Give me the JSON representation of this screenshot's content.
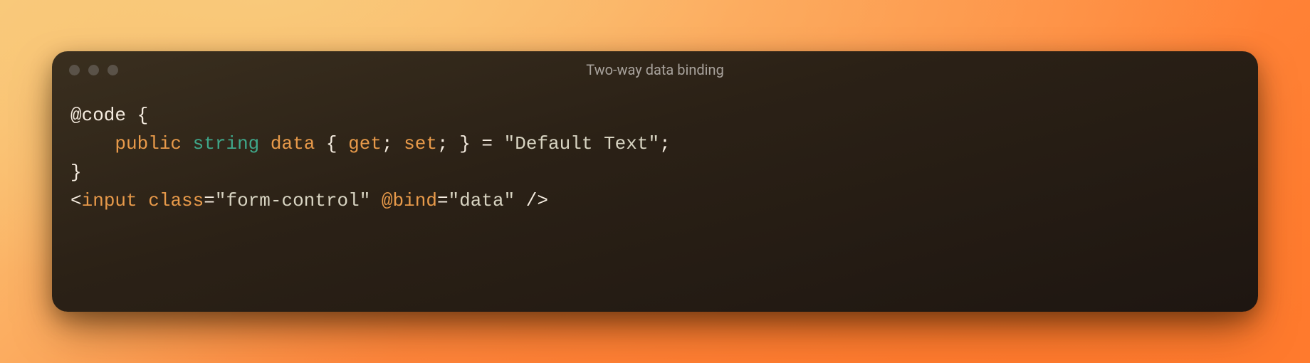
{
  "window": {
    "title": "Two-way data binding"
  },
  "code": {
    "indent_unit": "    ",
    "lines": {
      "l1": {
        "directive": "@code",
        "open_brace": "{"
      },
      "l2": {
        "kw_public": "public",
        "kw_type": "string",
        "ident": "data",
        "open_brace": "{",
        "get_kw": "get",
        "semi1": ";",
        "set_kw": "set",
        "semi2": ";",
        "close_brace": "}",
        "assign": "=",
        "string_open": "\"",
        "string_val": "Default Text",
        "string_close": "\"",
        "semi3": ";"
      },
      "l3": {
        "close_brace": "}"
      },
      "l4_blank": "",
      "l5": {
        "lt": "<",
        "tag": "input",
        "attr_class": "class",
        "eq1": "=",
        "class_q_open": "\"",
        "class_val": "form-control",
        "class_q_close": "\"",
        "attr_bind": "@bind",
        "eq2": "=",
        "bind_q_open": "\"",
        "bind_val": "data",
        "bind_q_close": "\"",
        "self_close": "/>"
      }
    }
  }
}
